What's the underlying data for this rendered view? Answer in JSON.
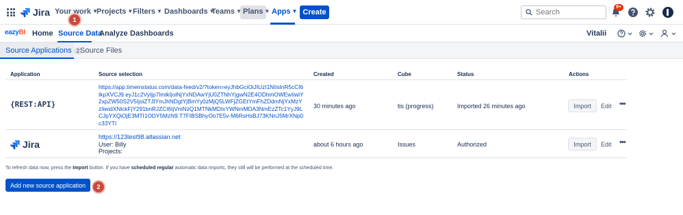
{
  "jira": {
    "product": "Jira",
    "nav": [
      {
        "label": "Your work"
      },
      {
        "label": "Projects"
      },
      {
        "label": "Filters"
      },
      {
        "label": "Dashboards"
      },
      {
        "label": "Teams"
      },
      {
        "label": "Plans"
      },
      {
        "label": "Apps"
      }
    ],
    "create_label": "Create",
    "search_placeholder": "Search",
    "notifications_badge": "9+"
  },
  "eazybi": {
    "logo_part1": "eazy",
    "logo_part2": "BI",
    "tabs": [
      "Home",
      "Source Data",
      "Analyze",
      "Dashboards"
    ],
    "active_tab": "Source Data",
    "user": "Vitalii"
  },
  "subtabs": {
    "applications_label": "Source Applications",
    "applications_count": "2",
    "files_label": "Source Files"
  },
  "table": {
    "headers": [
      "Application",
      "Source selection",
      "Created",
      "Cube",
      "Status",
      "Actions"
    ],
    "rows": [
      {
        "application": "{REST:API}",
        "source": "https://app.timeinstatus.com/data-feed/v2/?token=eyJhbGciOiJIUzI1NiIsInR5cCI6IkpXVCJ9.eyJ1c2VyIjp7ImlkIjoiNjYxNDAwYjU0ZTNhYjgwN2E4ODhmOWEwIiwiY2xpZW50S2V5IjoiZTJlYmJhNDgtYjBmYy0zMjQ5LWFjZGEtYmFhZDdmNjYxMzYzIiwidXNlckFjY291bnRJZCI6IjVmNzQ1MTNkMDIxYWNmMDA3NmEzZTc1YyJ9LCJpYXQiOjE3MTI1ODY5MzN9.T7FIBSBhyOo7E5v-M6RsHsBJ73KNnJ5MrXNp0c33YTI",
        "created": "30 minutes ago",
        "cube": "tis (progress)",
        "status": "Imported 26 minutes ago",
        "import_label": "Import",
        "edit_label": "Edit",
        "more_label": "•••"
      },
      {
        "application": "Jira",
        "source_url": "https://123test98.atlassian.net",
        "source_user": "User: Billy",
        "source_projects": "Projects:",
        "created": "about 6 hours ago",
        "cube": "Issues",
        "status": "Authorized",
        "import_label": "Import",
        "edit_label": "Edit",
        "more_label": "•••"
      }
    ]
  },
  "note": {
    "part1": "To refresh data now, press the ",
    "part2": "Import",
    "part3": " button. If you have ",
    "part4": "scheduled regular",
    "part5": " automatic data imports, they still will be performed at the scheduled time."
  },
  "add_button_label": "Add new source application",
  "steps": [
    "1",
    "2"
  ],
  "colors": {
    "primary": "#0052cc",
    "step_marker": "#c9493c",
    "badge": "#de350b"
  }
}
